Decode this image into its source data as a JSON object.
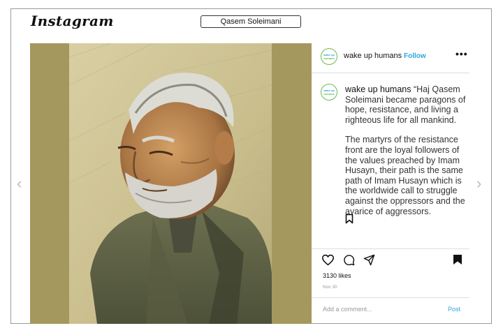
{
  "header": {
    "logo": "Instagram",
    "search_value": "Qasem Soleimani"
  },
  "post": {
    "username": "wake up humans",
    "follow_label": "Follow",
    "more_label": "•••",
    "avatar_text": [
      "wake up",
      "humans"
    ],
    "caption_paragraph_1": "“Haj Qasem Soleimani became paragons of hope, resistance, and living a righteous life for all mankind.",
    "caption_paragraph_2": "The martyrs of the resistance front are the loyal followers of the values preached by Imam Husayn, their path is the same path of Imam Husayn which is the worldwide call to struggle against the oppressors and the avarice of aggressors.",
    "likes": "3130 likes",
    "date": "Nov 30",
    "comment_placeholder": "Add a comment...",
    "post_label": "Post"
  },
  "nav": {
    "prev_icon": "‹",
    "next_icon": "›"
  },
  "colors": {
    "accent": "#2aa6e0",
    "image_background": "#a4985f",
    "avatar_ring": "#6db84a"
  }
}
